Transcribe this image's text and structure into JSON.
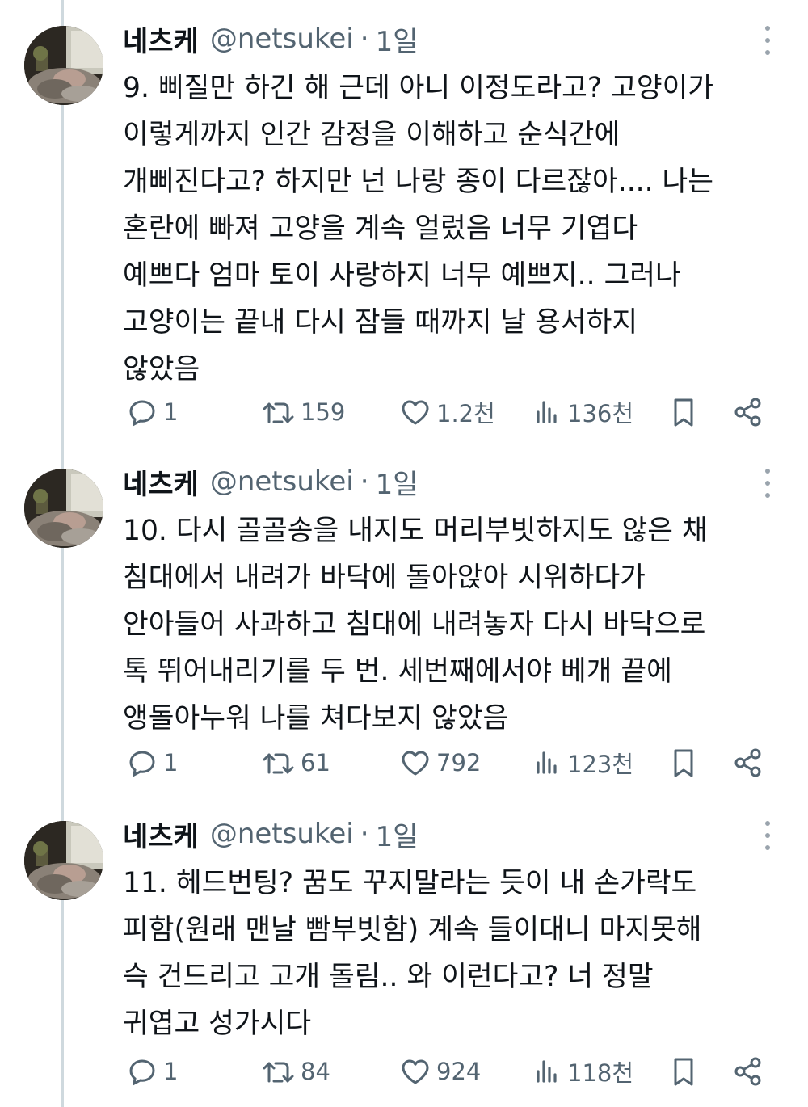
{
  "tweets": [
    {
      "name": "네츠케",
      "handle": "@netsukei",
      "separator": "·",
      "time": "1일",
      "lines": [
        "9. 삐질만 하긴 해 근데 아니 이정도라고? 고양이가",
        "이렇게까지 인간 감정을 이해하고 순식간에",
        "개삐진다고? 하지만 넌 나랑 종이 다르잖아.... 나는",
        "혼란에 빠져 고양을 계속 얼렀음 너무 기엽다",
        "예쁘다 엄마 토이 사랑하지 너무 예쁘지.. 그러나",
        "고양이는 끝내 다시 잠들 때까지 날 용서하지",
        "않았음"
      ],
      "replies": "1",
      "retweets": "159",
      "likes": "1.2천",
      "views": "136천"
    },
    {
      "name": "네츠케",
      "handle": "@netsukei",
      "separator": "·",
      "time": "1일",
      "lines": [
        "10. 다시 골골송을 내지도 머리부빗하지도 않은 채",
        "침대에서 내려가 바닥에 돌아앉아 시위하다가",
        "안아들어 사과하고 침대에 내려놓자 다시 바닥으로",
        "톡 뛰어내리기를 두 번. 세번째에서야 베개 끝에",
        "앵돌아누워 나를 쳐다보지 않았음"
      ],
      "replies": "1",
      "retweets": "61",
      "likes": "792",
      "views": "123천"
    },
    {
      "name": "네츠케",
      "handle": "@netsukei",
      "separator": "·",
      "time": "1일",
      "lines": [
        "11. 헤드번팅? 꿈도 꾸지말라는 듯이 내 손가락도",
        "피함(원래 맨날 빰부빗함) 계속 들이대니 마지못해",
        "슥 건드리고 고개 돌림.. 와 이런다고? 너 정말",
        "귀엽고 성가시다"
      ],
      "replies": "1",
      "retweets": "84",
      "likes": "924",
      "views": "118천"
    }
  ],
  "colors": {
    "text": "#0f1419",
    "secondary": "#536471",
    "thread_line": "#cfd9de"
  }
}
